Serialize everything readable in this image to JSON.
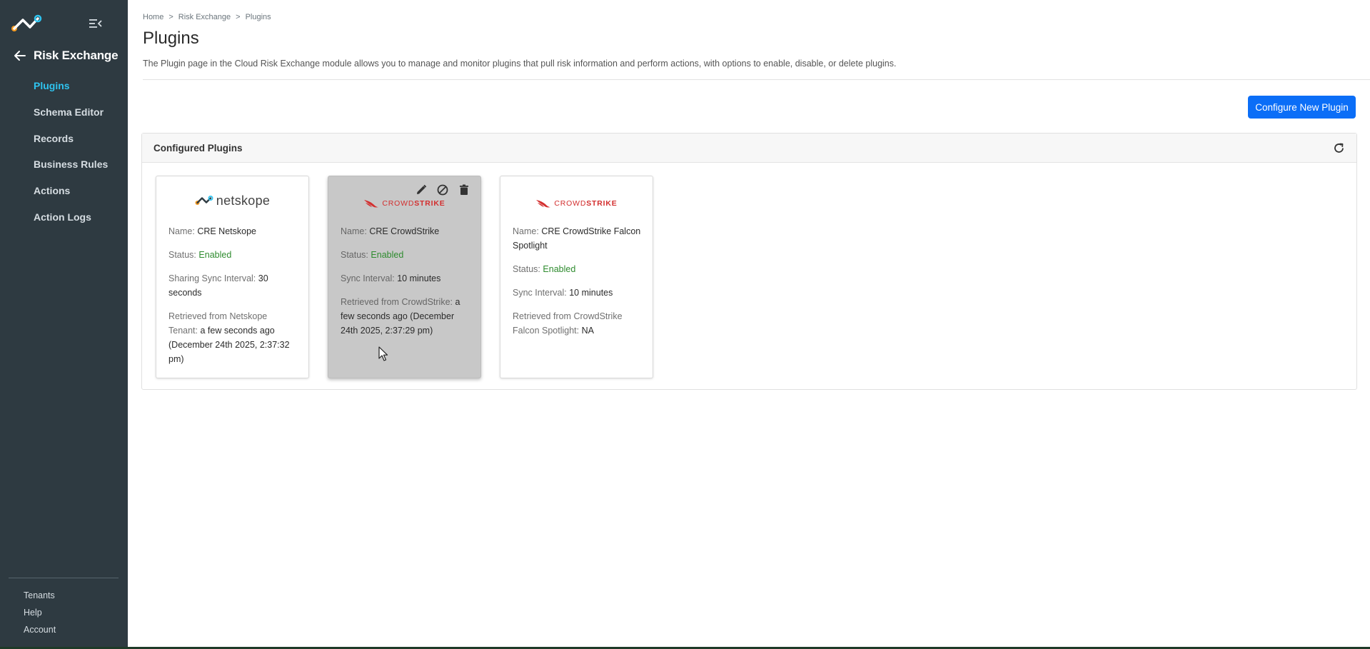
{
  "sidebar": {
    "module_title": "Risk Exchange",
    "items": [
      {
        "label": "Plugins",
        "active": true
      },
      {
        "label": "Schema Editor",
        "active": false
      },
      {
        "label": "Records",
        "active": false
      },
      {
        "label": "Business Rules",
        "active": false
      },
      {
        "label": "Actions",
        "active": false
      },
      {
        "label": "Action Logs",
        "active": false
      }
    ],
    "bottom_items": [
      {
        "label": "Tenants"
      },
      {
        "label": "Help"
      },
      {
        "label": "Account"
      }
    ]
  },
  "breadcrumb": [
    "Home",
    ">",
    "Risk Exchange",
    ">",
    "Plugins"
  ],
  "page": {
    "title": "Plugins",
    "description": "The Plugin page in the Cloud Risk Exchange module allows you to manage and monitor plugins that pull risk information and perform actions, with options to enable, disable, or delete plugins.",
    "configure_button": "Configure New Plugin"
  },
  "panel": {
    "title": "Configured Plugins"
  },
  "cards": [
    {
      "logo": "netskope",
      "logo_text": "netskope",
      "name_label": "Name:",
      "name": "CRE Netskope",
      "status_label": "Status:",
      "status": "Enabled",
      "interval_label": "Sharing Sync Interval:",
      "interval": "30 seconds",
      "retrieved_label": "Retrieved from Netskope Tenant:",
      "retrieved": "a few seconds ago (December 24th 2025, 2:37:32 pm)"
    },
    {
      "logo": "crowdstrike",
      "logo_text_a": "CROWD",
      "logo_text_b": "STRIKE",
      "name_label": "Name:",
      "name": "CRE CrowdStrike",
      "status_label": "Status:",
      "status": "Enabled",
      "interval_label": "Sync Interval:",
      "interval": "10 minutes",
      "retrieved_label": "Retrieved from CrowdStrike:",
      "retrieved": "a few seconds ago (December 24th 2025, 2:37:29 pm)",
      "hovered": true,
      "actions": [
        "edit-icon",
        "disable-icon",
        "delete-icon"
      ]
    },
    {
      "logo": "crowdstrike",
      "logo_text_a": "CROWD",
      "logo_text_b": "STRIKE",
      "name_label": "Name:",
      "name": "CRE CrowdStrike Falcon Spotlight",
      "status_label": "Status:",
      "status": "Enabled",
      "interval_label": "Sync Interval:",
      "interval": "10 minutes",
      "retrieved_label": "Retrieved from CrowdStrike Falcon Spotlight:",
      "retrieved": "NA"
    }
  ],
  "colors": {
    "sidebar_bg": "#2e3a41",
    "active_nav": "#2ec4f0",
    "primary_button": "#0b6ef7",
    "enabled_status": "#2e8b2e",
    "crowdstrike_red": "#d32f2f"
  }
}
